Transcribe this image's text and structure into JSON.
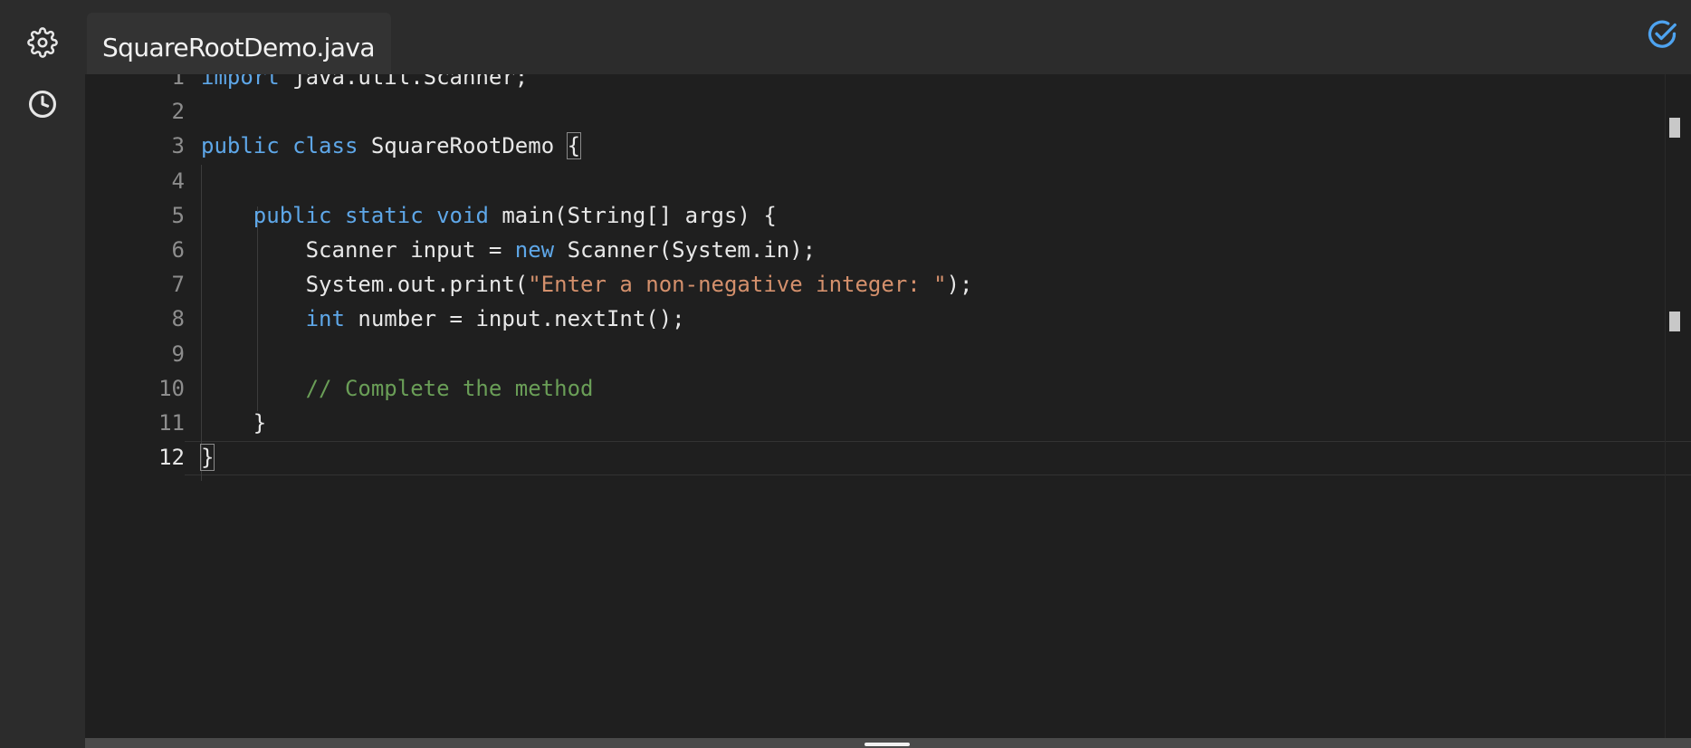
{
  "tab": {
    "label": "SquareRootDemo.java"
  },
  "icons": {
    "settings": "gear-icon",
    "history": "clock-icon",
    "check": "check-circle-icon"
  },
  "colors": {
    "keyword": "#5ea7e8",
    "string": "#d4906c",
    "comment": "#6a9e57",
    "accent": "#4ea3f0",
    "run": "#2fb36a"
  },
  "editor": {
    "active_line": 12,
    "line_numbers": [
      "1",
      "2",
      "3",
      "4",
      "5",
      "6",
      "7",
      "8",
      "9",
      "10",
      "11",
      "12"
    ],
    "lines": [
      [
        {
          "t": "kw",
          "v": "import"
        },
        {
          "t": "",
          "v": " java.util.Scanner;"
        }
      ],
      [],
      [
        {
          "t": "kw",
          "v": "public"
        },
        {
          "t": "",
          "v": " "
        },
        {
          "t": "kw",
          "v": "class"
        },
        {
          "t": "",
          "v": " SquareRootDemo "
        },
        {
          "t": "br",
          "v": "{"
        }
      ],
      [],
      [
        {
          "t": "",
          "v": "    "
        },
        {
          "t": "kw",
          "v": "public"
        },
        {
          "t": "",
          "v": " "
        },
        {
          "t": "kw",
          "v": "static"
        },
        {
          "t": "",
          "v": " "
        },
        {
          "t": "kw",
          "v": "void"
        },
        {
          "t": "",
          "v": " main(String[] args) {"
        }
      ],
      [
        {
          "t": "",
          "v": "        Scanner input = "
        },
        {
          "t": "kw",
          "v": "new"
        },
        {
          "t": "",
          "v": " Scanner(System.in);"
        }
      ],
      [
        {
          "t": "",
          "v": "        System.out.print("
        },
        {
          "t": "str",
          "v": "\"Enter a non-negative integer: \""
        },
        {
          "t": "",
          "v": ");"
        }
      ],
      [
        {
          "t": "",
          "v": "        "
        },
        {
          "t": "kw",
          "v": "int"
        },
        {
          "t": "",
          "v": " number = input.nextInt();"
        }
      ],
      [],
      [
        {
          "t": "",
          "v": "        "
        },
        {
          "t": "cmt",
          "v": "// Complete the method"
        }
      ],
      [
        {
          "t": "",
          "v": "    }"
        }
      ],
      [
        {
          "t": "br",
          "v": "}"
        }
      ]
    ]
  }
}
